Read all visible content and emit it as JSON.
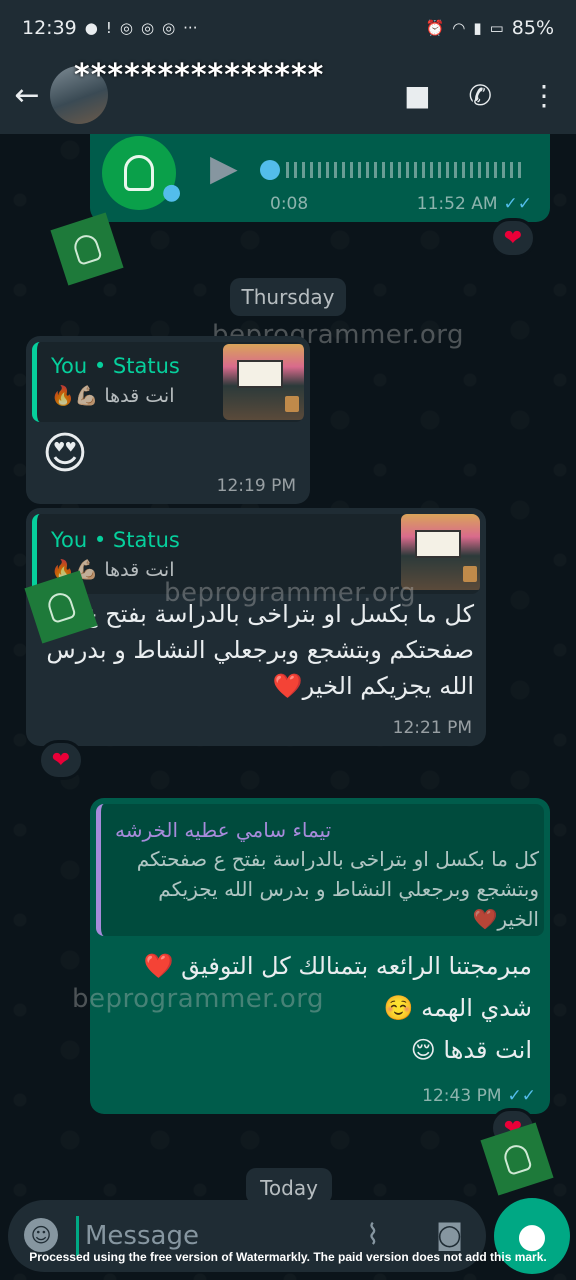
{
  "status_bar": {
    "time": "12:39",
    "left_icons": [
      "chat-bubble-icon",
      "alert-icon",
      "chrome-icon",
      "chrome-icon",
      "chrome-icon",
      "more-dots-icon"
    ],
    "battery": "85%"
  },
  "header": {
    "contact_name": "***************",
    "back_icon": "←",
    "video_icon": "■",
    "call_icon": "✆",
    "menu_icon": "⋮"
  },
  "messages": {
    "voice": {
      "duration": "0:08",
      "time": "11:52 AM",
      "reaction": "❤"
    },
    "date_divider": "Thursday",
    "status_reply_1": {
      "quote_title": "You • Status",
      "quote_text": "انت قدها 💪🏻🔥",
      "body": "😍",
      "time": "12:19 PM"
    },
    "status_reply_2": {
      "quote_title": "You • Status",
      "quote_text": "انت قدها 💪🏻🔥",
      "body": "كل ما بكسل او بتراخى بالدراسة بفتح ع صفحتكم وبتشجع وبرجعلي النشاط و بدرس الله يجزيكم الخير❤️",
      "time": "12:21 PM",
      "reaction": "❤"
    },
    "reply_out": {
      "quote_author": "تيماء سامي عطيه الخرشه",
      "quote_text": "كل ما بكسل او بتراخى بالدراسة بفتح ع صفحتكم وبتشجع وبرجعلي النشاط و بدرس الله يجزيكم الخير❤️",
      "line1": "مبرمجتنا الرائعه بتمنالك كل التوفيق ❤️",
      "line2": "شدي الهمه ☺️",
      "line3": "انت قدها 😌",
      "time": "12:43 PM",
      "reaction": "❤"
    },
    "today_divider": "Today"
  },
  "watermark_text": "beprogrammer.org",
  "input": {
    "placeholder": "Message"
  },
  "footer_note": "Processed using the free version of Watermarkly. The paid version does not add this mark.",
  "colors": {
    "incoming": "#1f2c34",
    "outgoing": "#005c4b",
    "accent": "#00a884",
    "quote_green": "#06cf9c",
    "quote_purple": "#a78bdb",
    "heart": "#ea0038"
  }
}
